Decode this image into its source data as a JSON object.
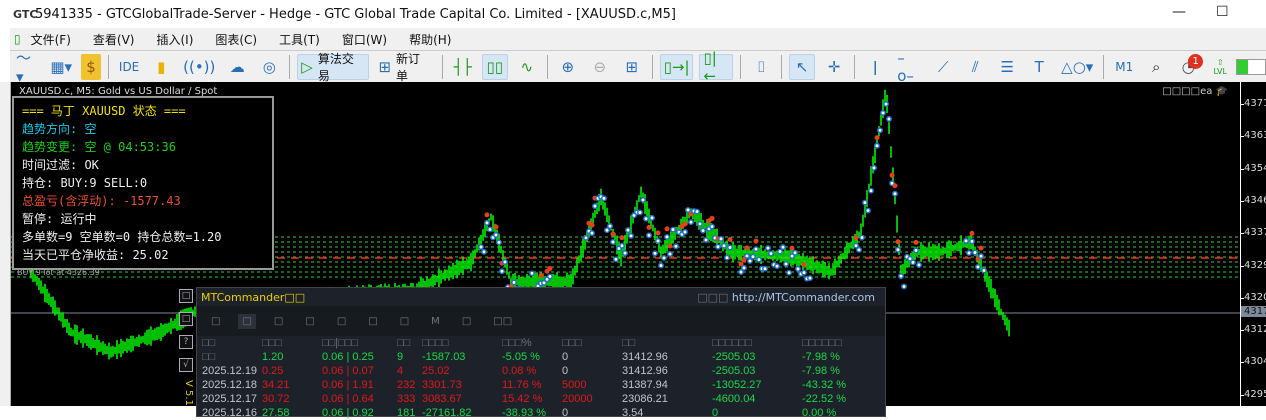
{
  "window": {
    "logo": "GTC",
    "title": "5941335 - GTCGlobalTrade-Server - Hedge - GTC Global Trade Capital Co. Limited - [XAUUSD.c,M5]",
    "minimize": "—",
    "maximize": "☐"
  },
  "menu": [
    "文件(F)",
    "查看(V)",
    "插入(I)",
    "图表(C)",
    "工具(T)",
    "窗口(W)",
    "帮助(H)"
  ],
  "toolbar": {
    "ide": "IDE",
    "algo": "算法交易",
    "new_order": "新订单",
    "timeframe": "M1",
    "notifications": "1",
    "lvl": "LVL"
  },
  "chart": {
    "symbol": "XAUUSD.c, M5:  Gold vs US Dollar / Spot",
    "ea_label": "□□□□ea",
    "price_ticks": [
      "4371",
      "4363",
      "4354",
      "4346",
      "4337",
      "4329",
      "4320",
      "4312",
      "4304",
      "4295"
    ],
    "current_price": "4317",
    "buy_line_label": "BUY 9 lot at 4326.39",
    "colors": {
      "price": "#00ff00",
      "buy_marker": "#1e6fc8",
      "sell_marker": "#e8401c",
      "levels": "#33cc33",
      "avg": "#ff2020"
    }
  },
  "status": {
    "title": "=== 马丁 XAUUSD 状态 ===",
    "trend": "趋势方向: 空",
    "trend_change": "趋势变更: 空 @ 04:53:36",
    "time_filter": "时间过滤: OK",
    "positions": "持仓: BUY:9   SELL:0",
    "pnl": "总盈亏(含浮动): -1577.43",
    "pause": "暂停: 运行中",
    "counts": "多单数=9 空单数=0 持仓总数=1.20",
    "today": "当天已平仓净收益: 25.02"
  },
  "panel": {
    "title": "MTCommander□□",
    "link_prefix": "□□□",
    "link": "http://MTCommander.com",
    "tabs": [
      "□",
      "□",
      "□",
      "□",
      "□",
      "□",
      "□",
      "M",
      "□",
      "□□"
    ],
    "side_buttons": [
      "□",
      "□",
      "?",
      "√"
    ],
    "version": "V 5.1",
    "headers": [
      "□□",
      "□□□",
      "□□|□□□",
      "□□",
      "□□□□",
      "□□□%",
      "□□□",
      "□□",
      "□□□□□□",
      "□□□□□□"
    ],
    "rows": [
      {
        "c": [
          "□□",
          "1.20",
          "0.06 | 0.25",
          "9",
          "-1587.03",
          "-5.05 %",
          "0",
          "31412.96",
          "-2505.03",
          "-7.98 %"
        ],
        "cls": [
          "h",
          "g",
          "g",
          "g",
          "g",
          "g",
          "w",
          "w",
          "g",
          "g"
        ]
      },
      {
        "c": [
          "2025.12.19",
          "0.25",
          "0.06 | 0.07",
          "4",
          "25.02",
          "0.08 %",
          "0",
          "31412.96",
          "-2505.03",
          "-7.98 %"
        ],
        "cls": [
          "w",
          "r",
          "r",
          "r",
          "r",
          "r",
          "w",
          "w",
          "g",
          "g"
        ]
      },
      {
        "c": [
          "2025.12.18",
          "34.21",
          "0.06 | 1.91",
          "232",
          "3301.73",
          "11.76 %",
          "5000",
          "31387.94",
          "-13052.27",
          "-43.32 %"
        ],
        "cls": [
          "w",
          "r",
          "r",
          "r",
          "r",
          "r",
          "r",
          "w",
          "g",
          "g"
        ]
      },
      {
        "c": [
          "2025.12.17",
          "30.72",
          "0.06 | 0.64",
          "333",
          "3083.67",
          "15.42 %",
          "20000",
          "23086.21",
          "-4600.04",
          "-22.52 %"
        ],
        "cls": [
          "w",
          "r",
          "r",
          "r",
          "r",
          "r",
          "r",
          "w",
          "g",
          "g"
        ]
      },
      {
        "c": [
          "2025.12.16",
          "27.58",
          "0.06 | 0.92",
          "181",
          "-27161.82",
          "-38.93 %",
          "0",
          "3.54",
          "0",
          "0.00 %"
        ],
        "cls": [
          "w",
          "g",
          "g",
          "g",
          "g",
          "g",
          "w",
          "w",
          "g",
          "g"
        ]
      }
    ]
  }
}
